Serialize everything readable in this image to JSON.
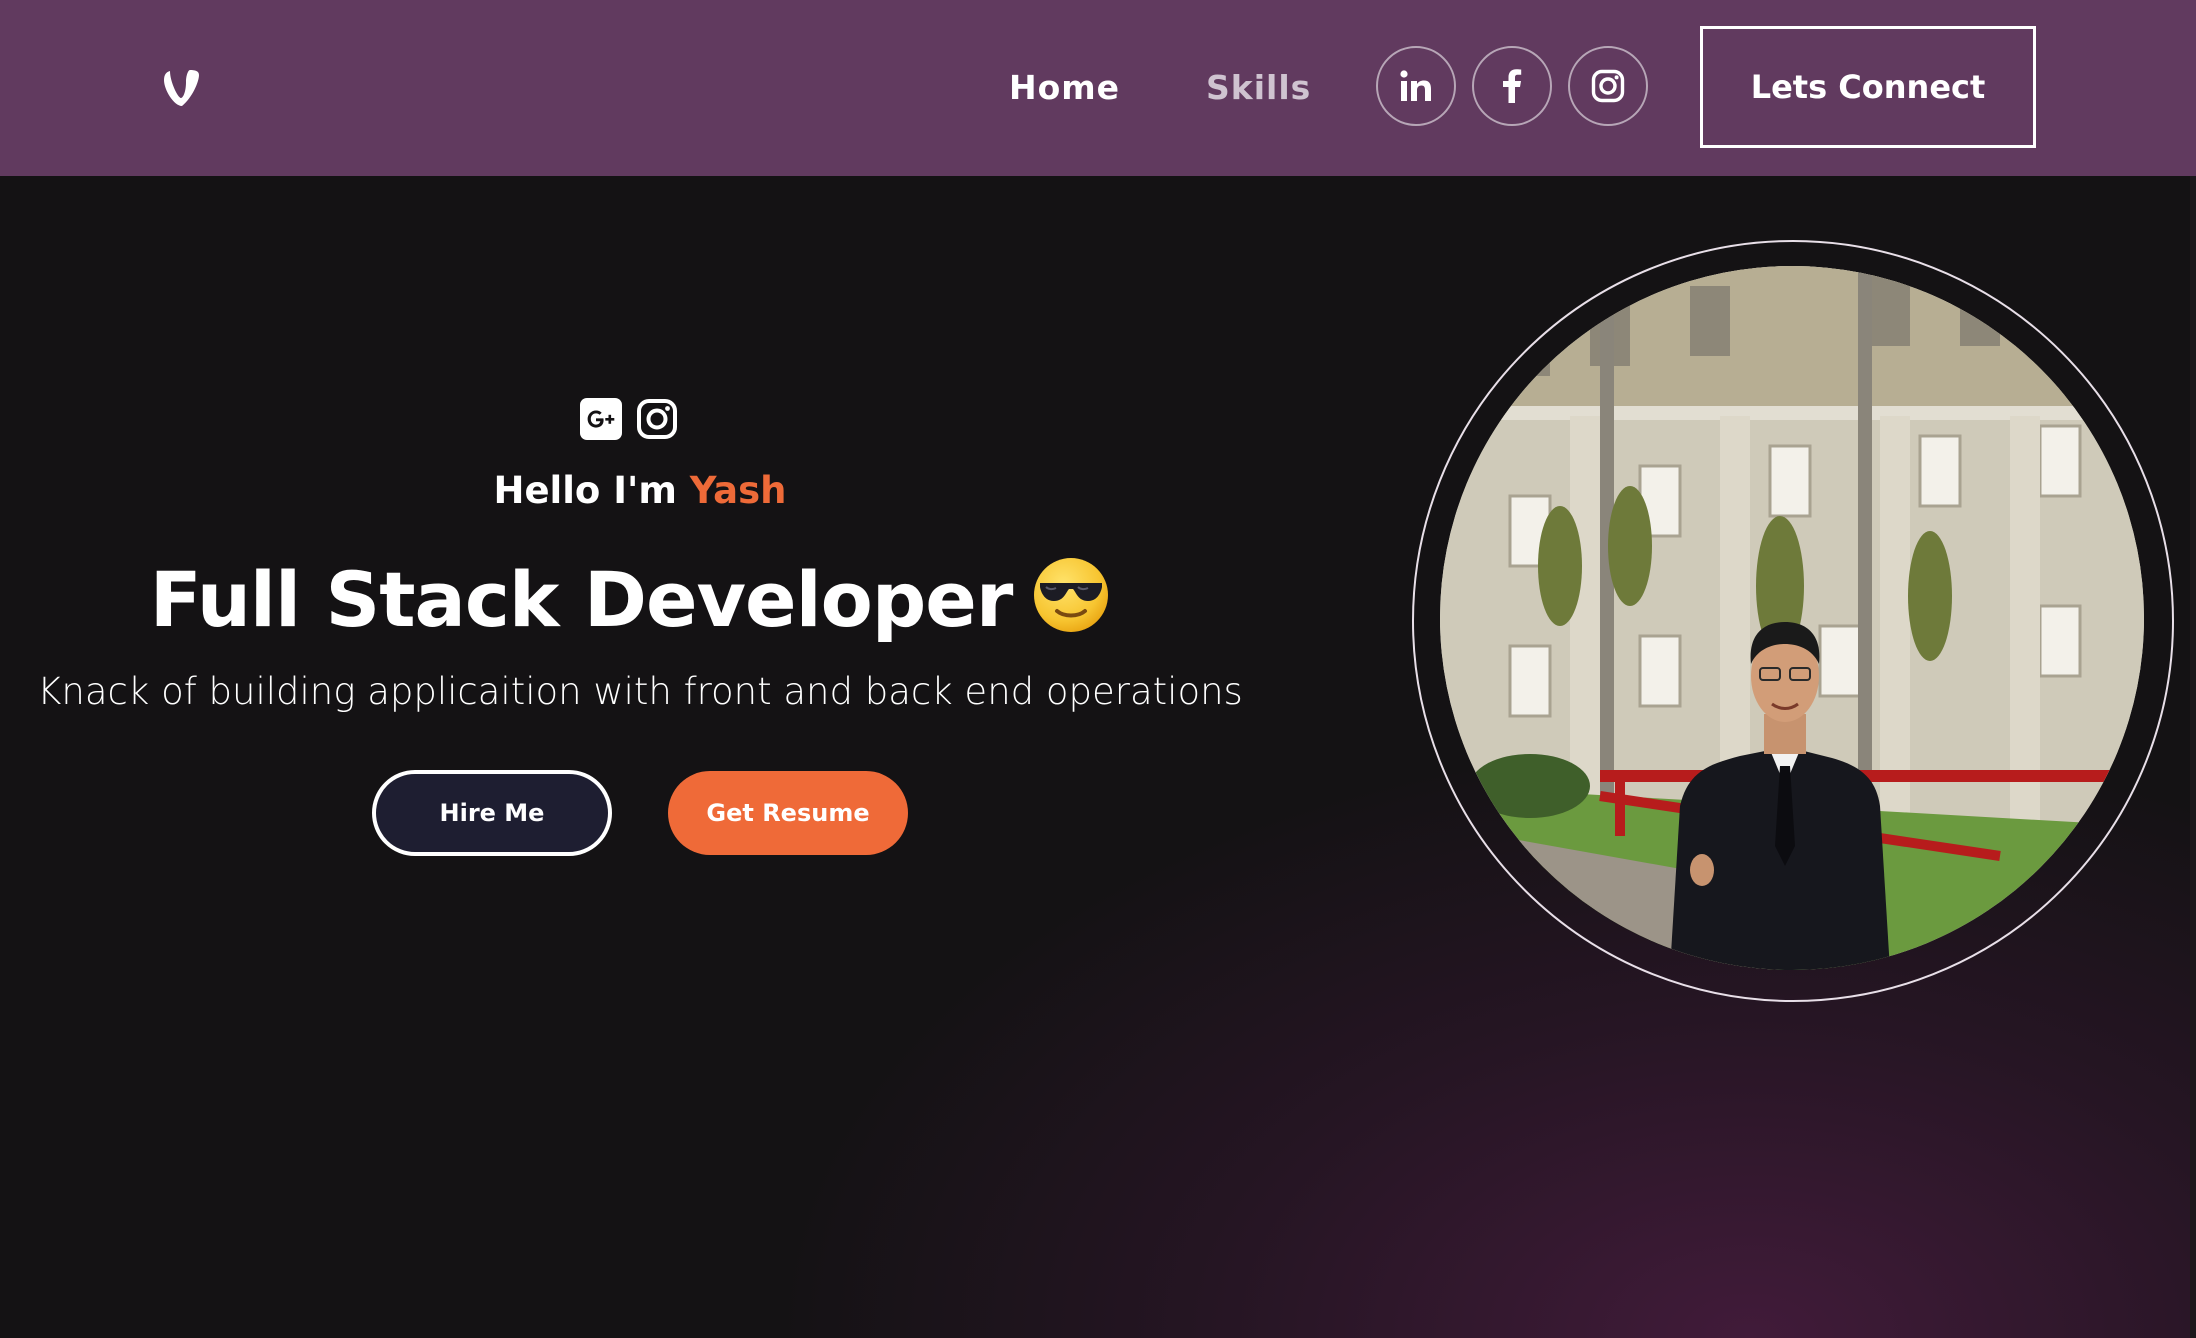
{
  "nav": {
    "logo_icon": "typo3-logo-icon",
    "links": [
      {
        "label": "Home"
      },
      {
        "label": "Skills"
      }
    ],
    "social_icons": [
      "linkedin-icon",
      "facebook-icon",
      "instagram-icon"
    ],
    "connect_label": "Lets Connect"
  },
  "hero": {
    "social_icons": [
      "google-plus-icon",
      "instagram-icon"
    ],
    "greeting_prefix": "Hello I'm ",
    "name": "Yash",
    "title": "Full Stack Developer",
    "emoji_icon": "sunglasses-face-emoji-icon",
    "tagline": "Knack of building applicaition with front and back end operations",
    "hire_label": "Hire Me",
    "resume_label": "Get Resume",
    "photo_icon": "profile-photo"
  },
  "colors": {
    "nav_bg": "#613a5f",
    "page_bg": "#141214",
    "accent": "#ee6a38",
    "hire_bg": "#1e1e31"
  }
}
